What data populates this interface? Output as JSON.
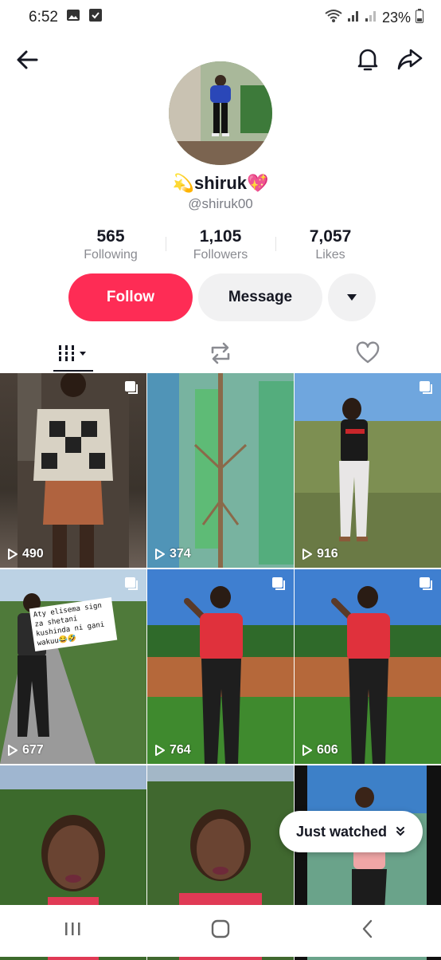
{
  "status_bar": {
    "time": "6:52",
    "battery": "23%"
  },
  "profile": {
    "display_name": "💫shiruk💖",
    "username": "@shiruk00",
    "stats": [
      {
        "value": "565",
        "label": "Following"
      },
      {
        "value": "1,105",
        "label": "Followers"
      },
      {
        "value": "7,057",
        "label": "Likes"
      }
    ]
  },
  "actions": {
    "follow_label": "Follow",
    "message_label": "Message"
  },
  "videos": [
    {
      "views": "490",
      "multi": true
    },
    {
      "views": "374",
      "multi": false
    },
    {
      "views": "916",
      "multi": true
    },
    {
      "views": "677",
      "multi": true,
      "caption": "Aty elisema sign za shetani kushinda ni gani wakuu😂🤣"
    },
    {
      "views": "764",
      "multi": true
    },
    {
      "views": "606",
      "multi": true
    },
    {
      "views": "",
      "multi": false
    },
    {
      "views": "",
      "multi": false
    },
    {
      "views": "",
      "multi": false
    }
  ],
  "just_watched_label": "Just watched",
  "colors": {
    "accent": "#fe2c55",
    "secondary_btn": "#f1f1f2",
    "text": "#161823",
    "muted": "#8a8b91"
  }
}
